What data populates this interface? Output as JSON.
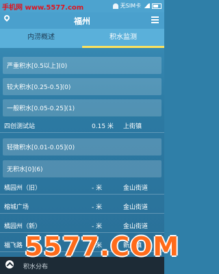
{
  "status_bar": {
    "watermark": "手机网 www.5577.com",
    "carrier": "无SIM卡"
  },
  "header": {
    "title": "福州"
  },
  "tabs": [
    {
      "label": "内涝概述",
      "active": false
    },
    {
      "label": "积水监测",
      "active": true
    }
  ],
  "groups": [
    {
      "label": "严重积水[0.5以上](0)"
    },
    {
      "label": "较大积水[0.25-0.5](0)"
    },
    {
      "label": "一般积水[0.05-0.25](1)"
    },
    {
      "label": "轻微积水[0.01-0.05](0)"
    },
    {
      "label": "无积水[0](6)"
    }
  ],
  "stations_general": [
    {
      "name": "四创测试站",
      "value": "0.15 米",
      "area": "上街镇"
    }
  ],
  "stations_none": [
    {
      "name": "橘园州（旧）",
      "value": "- 米",
      "area": "金山街道"
    },
    {
      "name": "榕城广场",
      "value": "- 米",
      "area": "金山街道"
    },
    {
      "name": "橘园州（新）",
      "value": "- 米",
      "area": "金山街道"
    },
    {
      "name": "福飞路",
      "value": "- 米",
      "area": "新店镇"
    }
  ],
  "bottom_bar": {
    "label": "积水分布"
  },
  "overlay_watermark": "5577.COM"
}
